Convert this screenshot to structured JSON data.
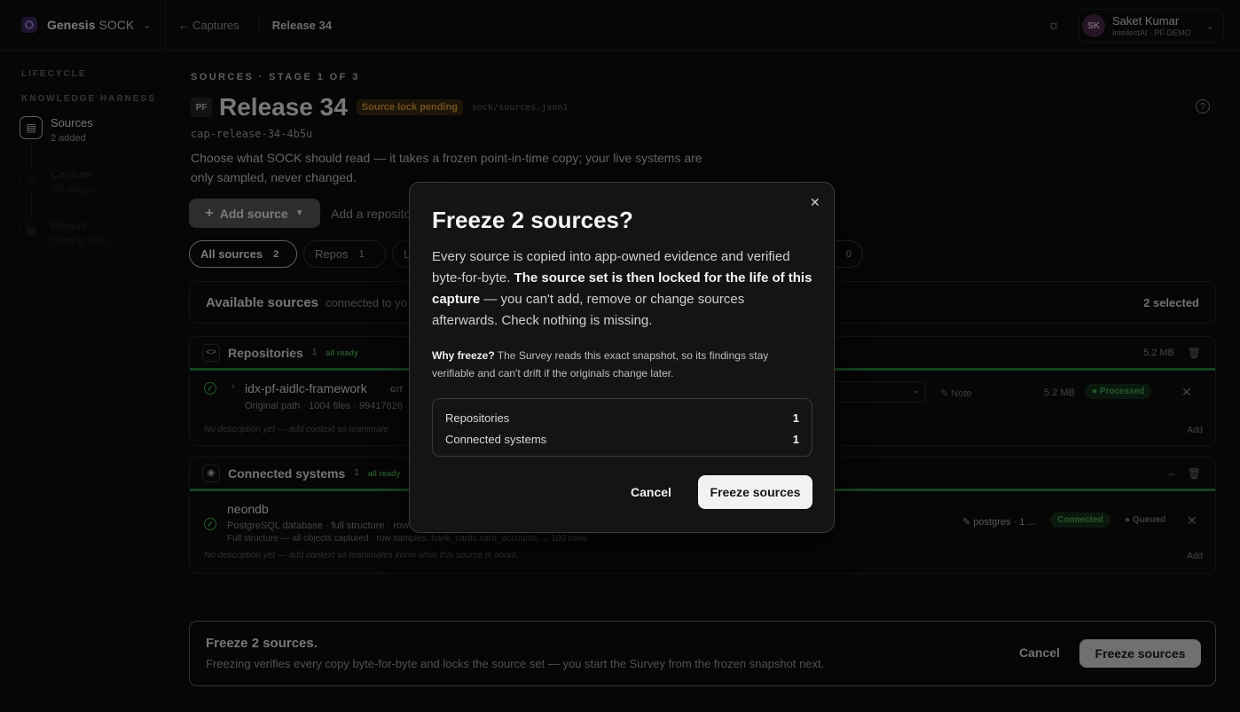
{
  "app": {
    "name": "Genesis",
    "product": "SOCK"
  },
  "nav": {
    "back": "Captures",
    "current": "Release 34"
  },
  "user": {
    "initials": "SK",
    "name": "Saket Kumar",
    "org": "IntellectAI · PF DEMO"
  },
  "sidebar": {
    "heading_lifecycle": "LIFECYCLE",
    "heading_harness": "KNOWLEDGE HARNESS",
    "steps": [
      {
        "label": "Sources",
        "sub": "2 added"
      },
      {
        "label": "Capture",
        "sub": "0/5 stages"
      },
      {
        "label": "Report",
        "sub": "Coming soon"
      }
    ]
  },
  "page": {
    "stage": "SOURCES · STAGE 1 OF 3",
    "badge": "PF",
    "title": "Release 34",
    "status": "Source lock pending",
    "file": "sock/sources.json1",
    "capture_id": "cap-release-34-4b5u",
    "description": "Choose what SOCK should read — it takes a frozen point-in-time copy; your live systems are only sampled, never changed.",
    "add_source": "Add source",
    "add_repo_hint": "Add a reposito"
  },
  "filters": [
    {
      "label": "All sources",
      "count": "2"
    },
    {
      "label": "Repos",
      "count": "1"
    },
    {
      "label": "L",
      "count": ""
    },
    {
      "label": "",
      "count": "0"
    }
  ],
  "available": {
    "title": "Available sources",
    "sub": "connected to yo",
    "selected": "2 selected"
  },
  "groups": {
    "repos": {
      "title": "Repositories",
      "count": "1",
      "ready": "all ready",
      "size": "5.2 MB",
      "row": {
        "name": "idx-pf-aidlc-framework",
        "tag": "GIT",
        "meta": "Original path · 1004 files · 99417626",
        "note": "Note",
        "size": "5.2 MB",
        "status": "Processed",
        "empty_note": "No description yet — add context so teammate",
        "add": "Add"
      }
    },
    "systems": {
      "title": "Connected systems",
      "count": "1",
      "ready": "all ready",
      "row": {
        "name": "neondb",
        "meta": "PostgreSQL database · full structure · row",
        "meta2": "Full structure — all objects captured · row samples: bank_cards.card_accounts → 100 rows",
        "conn": "postgres · 1 ...",
        "status": "Connected",
        "queue": "Queued",
        "empty_note": "No description yet — add context so teammates know what this source is about.",
        "add": "Add"
      }
    }
  },
  "freeze_bar": {
    "title": "Freeze 2 sources.",
    "sub": "Freezing verifies every copy byte-for-byte and locks the source set — you start the Survey from the frozen snapshot next.",
    "cancel": "Cancel",
    "freeze": "Freeze sources"
  },
  "modal": {
    "title": "Freeze 2 sources?",
    "body_1": "Every source is copied into app-owned evidence and verified byte-for-byte. ",
    "body_bold": "The source set is then locked for the life of this capture",
    "body_2": " — you can't add, remove or change sources afterwards. Check nothing is missing.",
    "why_label": "Why freeze?",
    "why_text": " The Survey reads this exact snapshot, so its findings stay verifiable and can't drift if the originals change later.",
    "rows": [
      {
        "label": "Repositories",
        "value": "1"
      },
      {
        "label": "Connected systems",
        "value": "1"
      }
    ],
    "cancel": "Cancel",
    "confirm": "Freeze sources"
  }
}
